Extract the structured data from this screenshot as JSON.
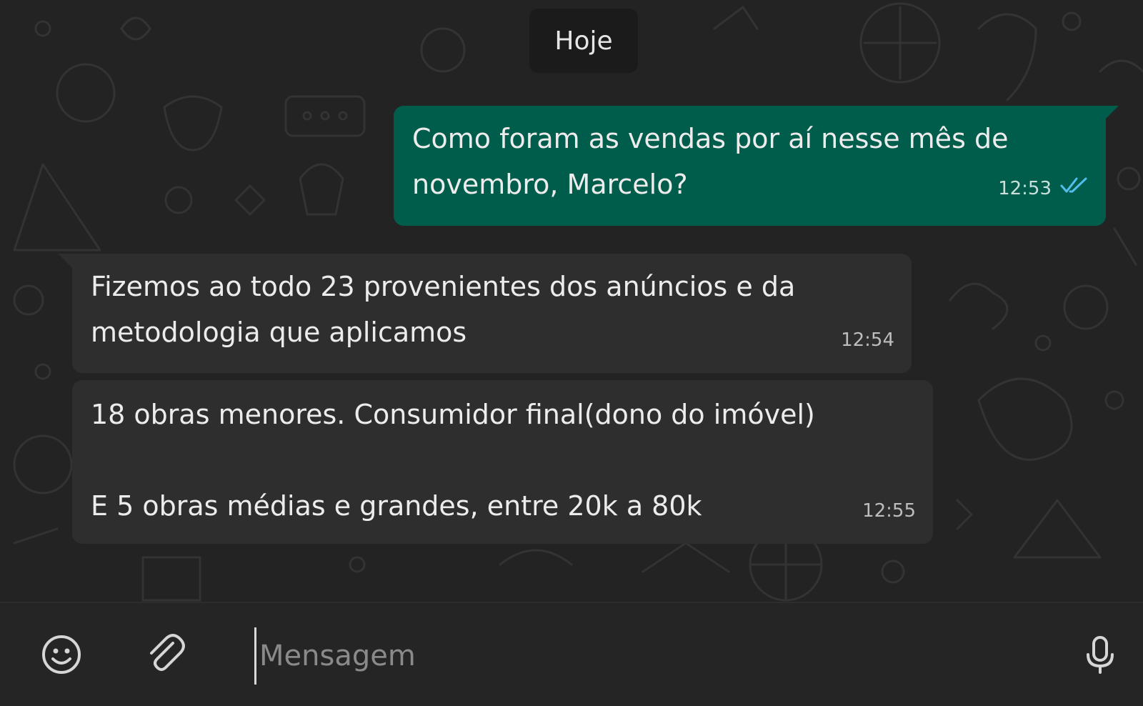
{
  "date_separator": "Hoje",
  "messages": [
    {
      "direction": "outgoing",
      "text": "Como foram as vendas por aí nesse mês de\nnovembro, Marcelo?",
      "time": "12:53",
      "status": "read",
      "status_icon": "double-check-icon"
    },
    {
      "direction": "incoming",
      "text": "Fizemos ao todo 23 provenientes dos anúncios e da\nmetodologia que aplicamos",
      "time": "12:54"
    },
    {
      "direction": "incoming",
      "text": "18 obras menores. Consumidor final(dono do imóvel)\n\nE 5 obras médias e grandes, entre 20k a 80k",
      "time": "12:55"
    }
  ],
  "composer": {
    "placeholder": "Mensagem",
    "value": "",
    "icons": [
      "emoji-icon",
      "paperclip-icon",
      "microphone-icon"
    ]
  },
  "colors": {
    "background": "#232323",
    "outgoing_bubble": "#005c4b",
    "incoming_bubble": "#2e2e2e",
    "read_check": "#53bdeb"
  }
}
